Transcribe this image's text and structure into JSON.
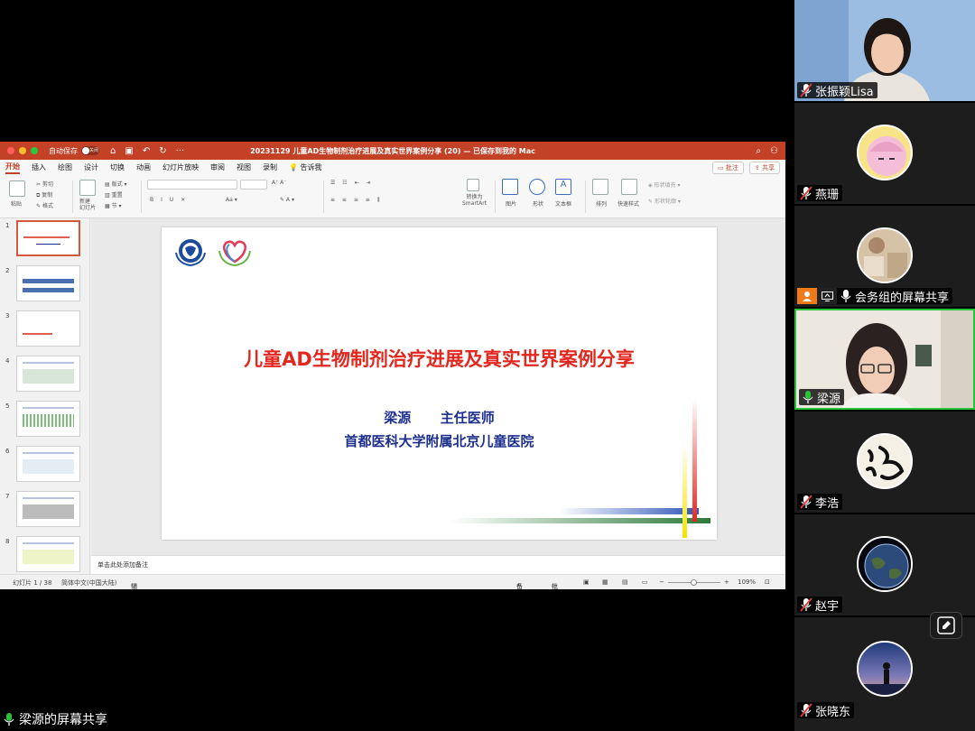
{
  "window": {
    "autosave_label": "自动保存",
    "autosave_state": "关闭",
    "title": "20231129 儿童AD生物制剂治疗进展及真实世界案例分享 (20) — 已保存到我的 Mac"
  },
  "tabs": [
    "开始",
    "插入",
    "绘图",
    "设计",
    "切换",
    "动画",
    "幻灯片放映",
    "审阅",
    "视图",
    "录制",
    "告诉我"
  ],
  "tab_actions": {
    "comments": "批注",
    "share": "共享"
  },
  "ribbon": {
    "clipboard": {
      "paste": "粘贴",
      "cut": "剪切",
      "copy": "复制",
      "format": "格式"
    },
    "slides": {
      "new_slide": "新建\n幻灯片",
      "layout": "版式",
      "reset": "重置",
      "section": "节"
    },
    "convert_smartart": "转换为\nSmartArt",
    "insert": {
      "picture": "图片",
      "shape": "形状",
      "textbox": "文本框"
    },
    "arrange": "排列",
    "quick_styles": "快速样式",
    "shape_fill": "形状填充",
    "shape_outline": "形状轮廓"
  },
  "thumbnails": [
    "1",
    "2",
    "3",
    "4",
    "5",
    "6",
    "7",
    "8"
  ],
  "slide": {
    "title": "儿童AD生物制剂治疗进展及真实世界案例分享",
    "author_name": "梁源",
    "author_role": "主任医师",
    "hospital": "首都医科大学附属北京儿童医院"
  },
  "notes_placeholder": "单击此处添加备注",
  "status_bar": {
    "slide_counter": "幻灯片 1 / 38",
    "language": "简体中文(中国大陆)",
    "accessibility": "辅助功能: 调查",
    "notes": "备注",
    "comments": "批注",
    "zoom": "109%"
  },
  "participants": [
    {
      "name": "张振颖Lisa",
      "type": "video"
    },
    {
      "name": "燕珊",
      "type": "avatar"
    },
    {
      "name": "会务组的屏幕共享",
      "type": "avatar",
      "host": true
    },
    {
      "name": "梁源",
      "type": "video",
      "speaking": true
    },
    {
      "name": "李浩",
      "type": "avatar"
    },
    {
      "name": "赵宇",
      "type": "avatar"
    },
    {
      "name": "张晓东",
      "type": "avatar"
    }
  ],
  "share_label": "梁源的屏幕共享",
  "colors": {
    "ppt_accent": "#c24127",
    "title_red": "#e2271f",
    "author_blue": "#1d2e8c",
    "speaking_green": "#27c43a"
  }
}
